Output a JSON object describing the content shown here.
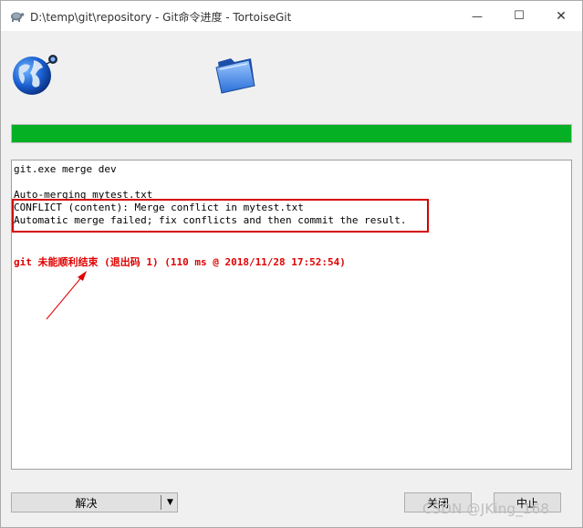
{
  "window": {
    "title": "D:\\temp\\git\\repository - Git命令进度 - TortoiseGit",
    "minimize_glyph": "—",
    "maximize_glyph": "☐",
    "close_glyph": "✕"
  },
  "icons": {
    "app_icon": "tortoise-icon",
    "remote": "globe-icon",
    "local": "folder-icon"
  },
  "progress": {
    "percent": 100,
    "color": "#06b025"
  },
  "log": {
    "lines": [
      "git.exe merge dev",
      "",
      "Auto-merging mytest.txt",
      "CONFLICT (content): Merge conflict in mytest.txt",
      "Automatic merge failed; fix conflicts and then commit the result."
    ],
    "error_line": "git 未能顺利结束 (退出码 1) (110 ms @ 2018/11/28 17:52:54)",
    "error_color": "#e00000",
    "highlight_color": "#d40000"
  },
  "buttons": {
    "resolve": "解决",
    "resolve_dropdown": "▼",
    "close": "关闭",
    "abort": "中止"
  },
  "watermark": "CSDN @JKing_168"
}
